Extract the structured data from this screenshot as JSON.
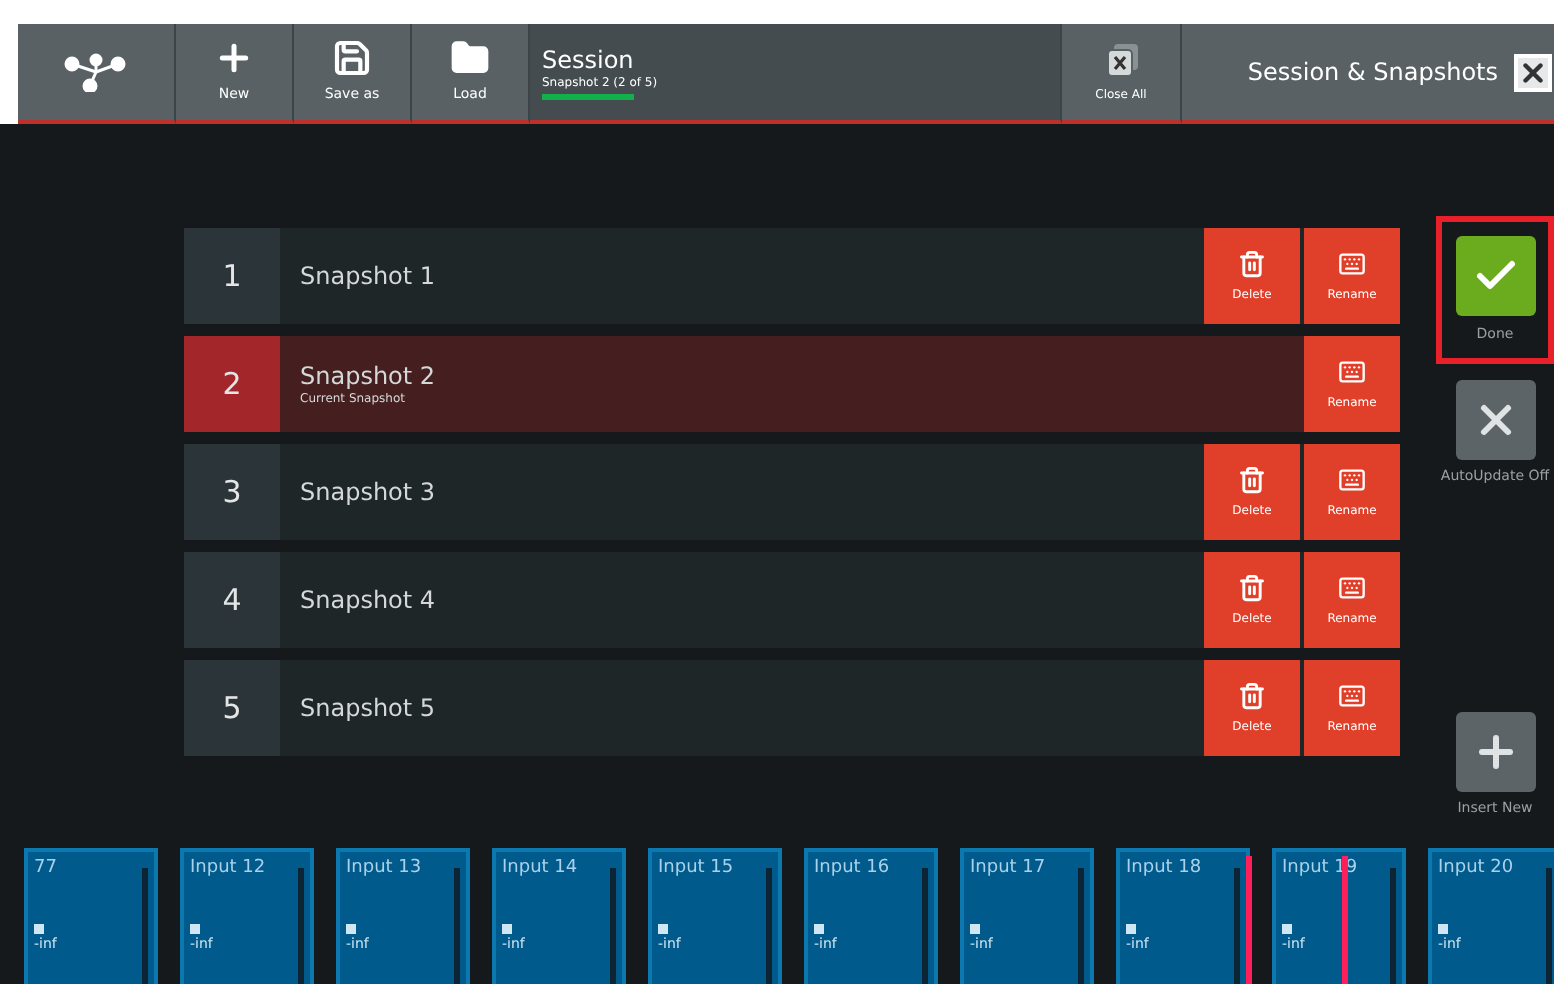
{
  "toolbar": {
    "buttons": [
      {
        "kind": "new",
        "label": "New"
      },
      {
        "kind": "save",
        "label": "Save as"
      },
      {
        "kind": "load",
        "label": "Load"
      }
    ],
    "session": {
      "title": "Session",
      "subtitle": "Snapshot 2 (2 of 5)"
    },
    "close_all": {
      "label": "Close All"
    },
    "panel_title": "Session & Snapshots"
  },
  "snapshots": [
    {
      "number": "1",
      "name": "Snapshot 1",
      "selected": false,
      "delete_label": "Delete",
      "rename_label": "Rename"
    },
    {
      "number": "2",
      "name": "Snapshot 2",
      "note": "Current Snapshot",
      "selected": true,
      "rename_label": "Rename"
    },
    {
      "number": "3",
      "name": "Snapshot 3",
      "selected": false,
      "delete_label": "Delete",
      "rename_label": "Rename"
    },
    {
      "number": "4",
      "name": "Snapshot 4",
      "selected": false,
      "delete_label": "Delete",
      "rename_label": "Rename"
    },
    {
      "number": "5",
      "name": "Snapshot 5",
      "selected": false,
      "delete_label": "Delete",
      "rename_label": "Rename"
    }
  ],
  "side_buttons": [
    {
      "kind": "done",
      "label": "Done",
      "highlighted": true
    },
    {
      "kind": "autoupdate",
      "label": "AutoUpdate Off",
      "highlighted": false
    },
    {
      "kind": "insert",
      "label": "Insert New",
      "highlighted": false
    }
  ],
  "channels": [
    {
      "name": "77",
      "reading": "-inf"
    },
    {
      "name": "Input 12",
      "reading": "-inf"
    },
    {
      "name": "Input 13",
      "reading": "-inf"
    },
    {
      "name": "Input 14",
      "reading": "-inf"
    },
    {
      "name": "Input 15",
      "reading": "-inf"
    },
    {
      "name": "Input 16",
      "reading": "-inf"
    },
    {
      "name": "Input 17",
      "reading": "-inf"
    },
    {
      "name": "Input 18",
      "reading": "-inf"
    },
    {
      "name": "Input 19",
      "reading": "-inf"
    },
    {
      "name": "Input 20",
      "reading": "-inf"
    }
  ]
}
